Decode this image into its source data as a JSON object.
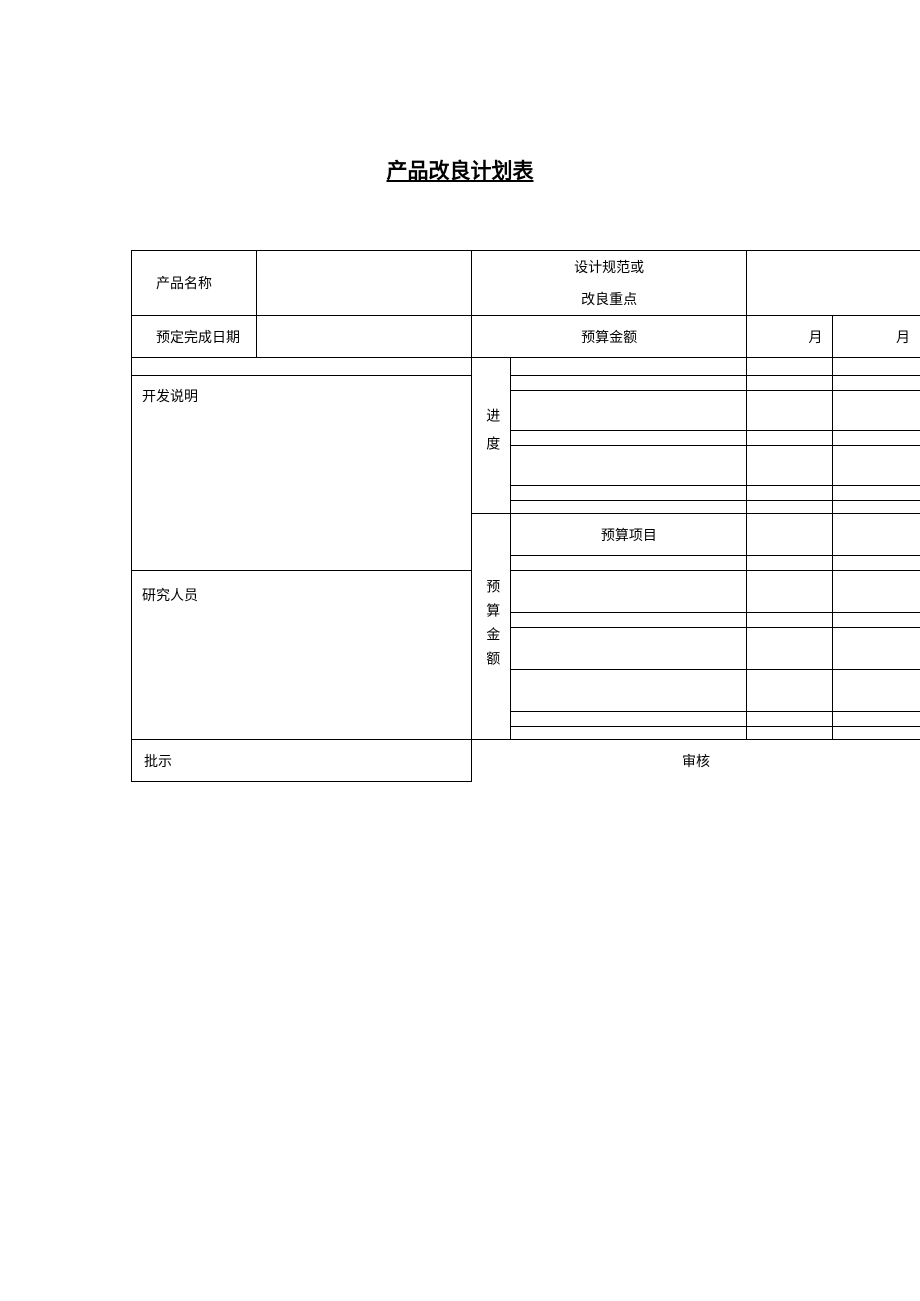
{
  "title": "产品改良计划表",
  "labels": {
    "product_name": "产品名称",
    "design_spec1": "设计规范或",
    "design_spec2": "改良重点",
    "planned_date": "预定完成日期",
    "budget_amount_label": "预算金额",
    "month": "月",
    "dev_desc": "开发说明",
    "progress": "进度",
    "researchers": "研究人员",
    "budget_item": "预算项目",
    "budget_amount_v": "预算金额",
    "approval": "批示",
    "review": "审核"
  }
}
